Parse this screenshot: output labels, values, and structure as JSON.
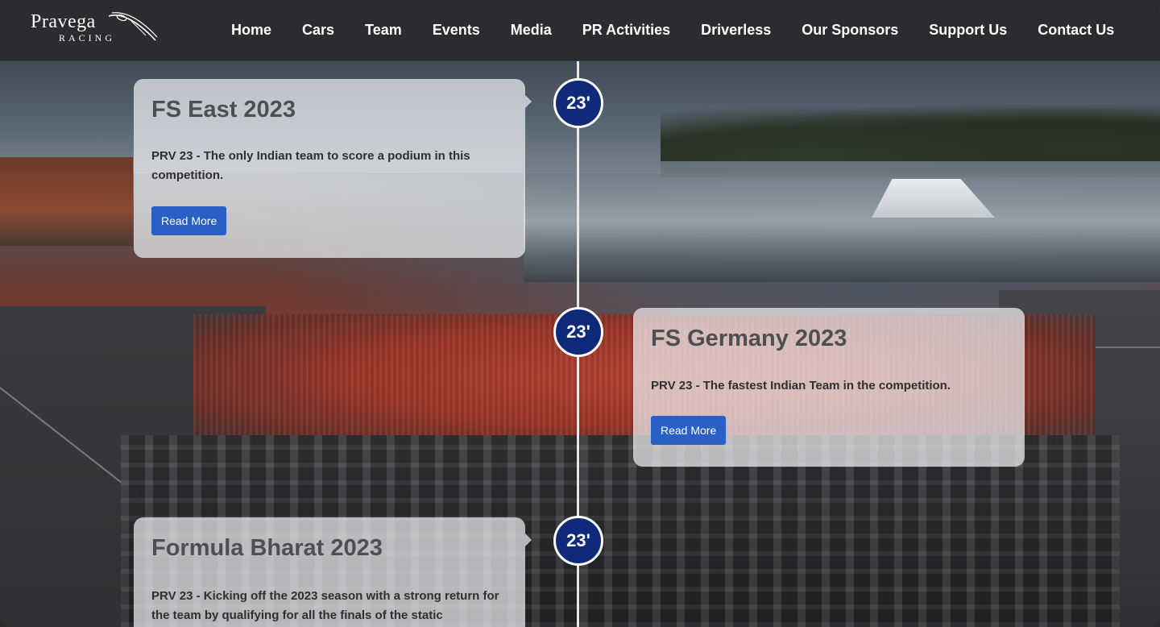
{
  "header": {
    "logo_text": "Pravega",
    "logo_subtext": "RACING",
    "nav": [
      {
        "label": "Home"
      },
      {
        "label": "Cars"
      },
      {
        "label": "Team"
      },
      {
        "label": "Events"
      },
      {
        "label": "Media"
      },
      {
        "label": "PR Activities"
      },
      {
        "label": "Driverless"
      },
      {
        "label": "Our Sponsors"
      },
      {
        "label": "Support Us"
      },
      {
        "label": "Contact Us"
      }
    ]
  },
  "timeline": [
    {
      "badge": "23'",
      "title": "FS East 2023",
      "text": "PRV 23 - The only Indian team to score a podium in this competition.",
      "button": "Read More"
    },
    {
      "badge": "23'",
      "title": "FS Germany 2023",
      "text": "PRV 23 - The fastest Indian Team in the competition.",
      "button": "Read More"
    },
    {
      "badge": "23'",
      "title": "Formula Bharat 2023",
      "text": "PRV 23 - Kicking off the 2023 season with a strong return for the team by qualifying for all the finals of the static"
    }
  ],
  "colors": {
    "header_bg": "#2b2c2f",
    "badge_bg": "#0e2a78",
    "button_bg": "#2a5fc6"
  }
}
